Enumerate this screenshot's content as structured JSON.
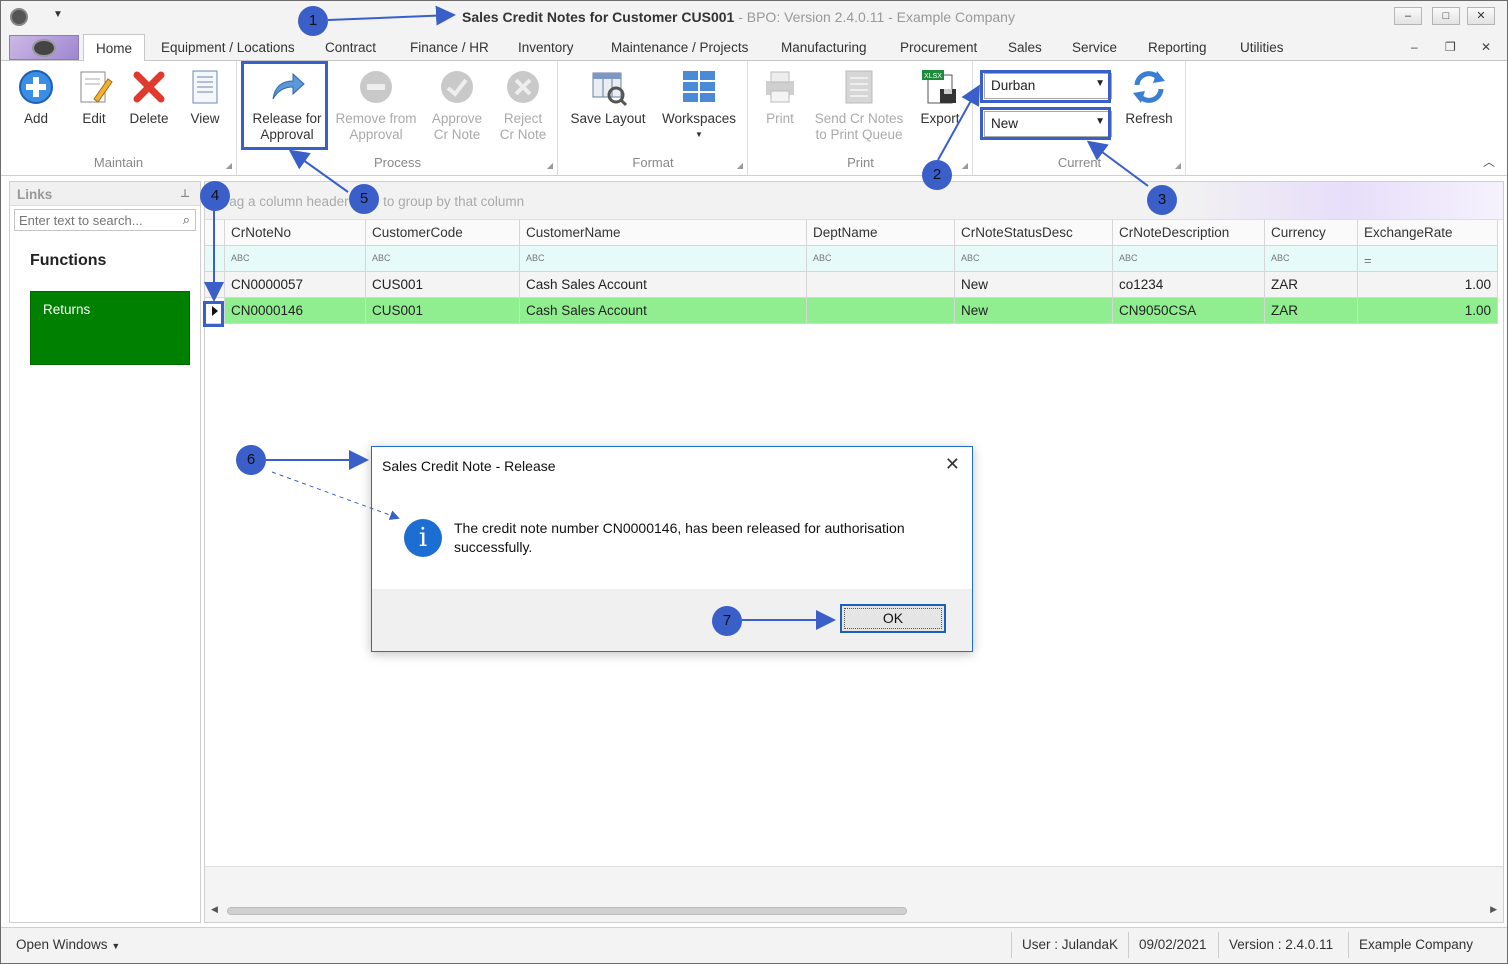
{
  "window": {
    "title_main": "Sales Credit Notes for Customer CUS001",
    "title_suffix": " - BPO: Version 2.4.0.11 - Example Company",
    "minimize": "‒",
    "maximize": "□",
    "close": "✕"
  },
  "menu": {
    "tabs": [
      "Home",
      "Equipment / Locations",
      "Contract",
      "Finance / HR",
      "Inventory",
      "Maintenance / Projects",
      "Manufacturing",
      "Procurement",
      "Sales",
      "Service",
      "Reporting",
      "Utilities"
    ],
    "active_tab": "Home"
  },
  "ribbon": {
    "maintain": {
      "label": "Maintain",
      "add": "Add",
      "edit": "Edit",
      "delete": "Delete",
      "view": "View"
    },
    "process": {
      "label": "Process",
      "release_l1": "Release for",
      "release_l2": "Approval",
      "remove_l1": "Remove from",
      "remove_l2": "Approval",
      "approve_l1": "Approve",
      "approve_l2": "Cr Note",
      "reject_l1": "Reject",
      "reject_l2": "Cr Note"
    },
    "format": {
      "label": "Format",
      "save_layout": "Save Layout",
      "workspaces": "Workspaces"
    },
    "print": {
      "label": "Print",
      "print": "Print",
      "send_l1": "Send Cr Notes",
      "send_l2": "to Print Queue",
      "export": "Export",
      "xlsx_badge": "XLSX"
    },
    "current": {
      "label": "Current",
      "site": "Durban",
      "status": "New",
      "refresh": "Refresh"
    }
  },
  "links": {
    "header": "Links",
    "search_placeholder": "Enter text to search...",
    "functions_title": "Functions",
    "returns": "Returns"
  },
  "grid": {
    "group_hint": "Drag a column header here to group by that column",
    "columns": [
      "CrNoteNo",
      "CustomerCode",
      "CustomerName",
      "DeptName",
      "CrNoteStatusDesc",
      "CrNoteDescription",
      "Currency",
      "ExchangeRate"
    ],
    "filter_glyph": "ABC",
    "filter_equals": "=",
    "rows": [
      {
        "CrNoteNo": "CN0000057",
        "CustomerCode": "CUS001",
        "CustomerName": "Cash Sales Account",
        "DeptName": "",
        "CrNoteStatusDesc": "New",
        "CrNoteDescription": "co1234",
        "Currency": "ZAR",
        "ExchangeRate": "1.00"
      },
      {
        "CrNoteNo": "CN0000146",
        "CustomerCode": "CUS001",
        "CustomerName": "Cash Sales Account",
        "DeptName": "",
        "CrNoteStatusDesc": "New",
        "CrNoteDescription": "CN9050CSA",
        "Currency": "ZAR",
        "ExchangeRate": "1.00"
      }
    ]
  },
  "status": {
    "open_windows": "Open Windows",
    "user": "User : JulandaK",
    "date": "09/02/2021",
    "version": "Version : 2.4.0.11",
    "company": "Example Company"
  },
  "dialog": {
    "title": "Sales Credit Note - Release",
    "message": "The credit note number CN0000146, has been released for authorisation successfully.",
    "ok": "OK"
  },
  "annotations": [
    "1",
    "2",
    "3",
    "4",
    "5",
    "6",
    "7"
  ],
  "colors": {
    "accent": "#3a5fc8",
    "selected_row": "#90ee90",
    "returns_tile": "#008000"
  }
}
